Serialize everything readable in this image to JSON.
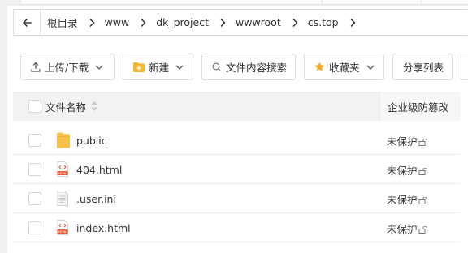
{
  "breadcrumb": {
    "items": [
      "根目录",
      "www",
      "dk_project",
      "wwwroot",
      "cs.top"
    ]
  },
  "toolbar": {
    "upload_label": "上传/下载",
    "new_label": "新建",
    "search_label": "文件内容搜索",
    "favorites_label": "收藏夹",
    "share_label": "分享列表"
  },
  "table": {
    "headers": {
      "name": "文件名称",
      "protection": "企业级防篡改"
    },
    "rows": [
      {
        "name": "public",
        "type": "folder",
        "protection": "未保护"
      },
      {
        "name": "404.html",
        "type": "html",
        "protection": "未保护"
      },
      {
        "name": ".user.ini",
        "type": "text",
        "protection": "未保护"
      },
      {
        "name": "index.html",
        "type": "html",
        "protection": "未保护"
      }
    ]
  },
  "colors": {
    "folder": "#f7c04a",
    "html_badge": "#e8613c",
    "star": "#f5a623",
    "new_icon": "#f5b731"
  }
}
